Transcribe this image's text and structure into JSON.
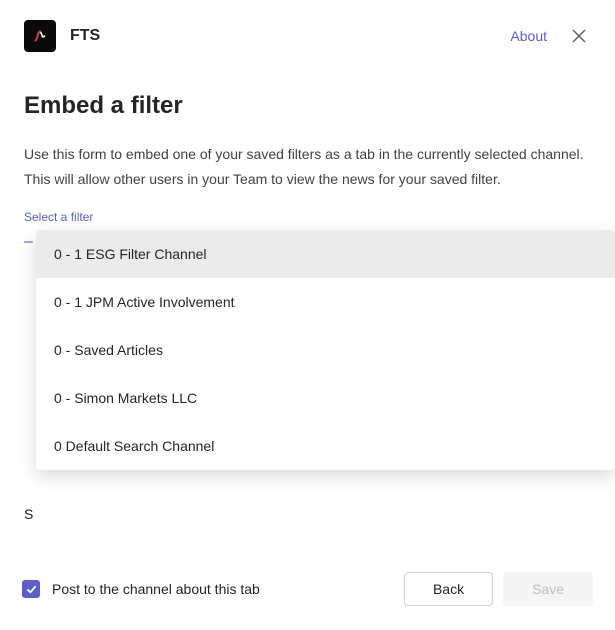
{
  "header": {
    "app_name": "FTS",
    "about_label": "About"
  },
  "page": {
    "title": "Embed a filter",
    "description": "Use this form to embed one of your saved filters as a tab in the currently selected channel. This will allow other users in your Team to view the news for your saved filter.",
    "field_label": "Select a filter",
    "behind_char": "S"
  },
  "dropdown": {
    "toggle_char": "–",
    "items": [
      {
        "label": "0 - 1 ESG Filter Channel",
        "highlighted": true
      },
      {
        "label": "0 - 1 JPM Active Involvement",
        "highlighted": false
      },
      {
        "label": "0 - Saved Articles",
        "highlighted": false
      },
      {
        "label": "0 - Simon Markets LLC",
        "highlighted": false
      },
      {
        "label": "0 Default Search Channel",
        "highlighted": false
      }
    ]
  },
  "footer": {
    "checkbox_label": "Post to the channel about this tab",
    "checkbox_checked": true,
    "back_label": "Back",
    "save_label": "Save",
    "save_disabled": true
  },
  "colors": {
    "accent": "#5b5fc7",
    "text": "#252525",
    "muted": "#424242"
  }
}
